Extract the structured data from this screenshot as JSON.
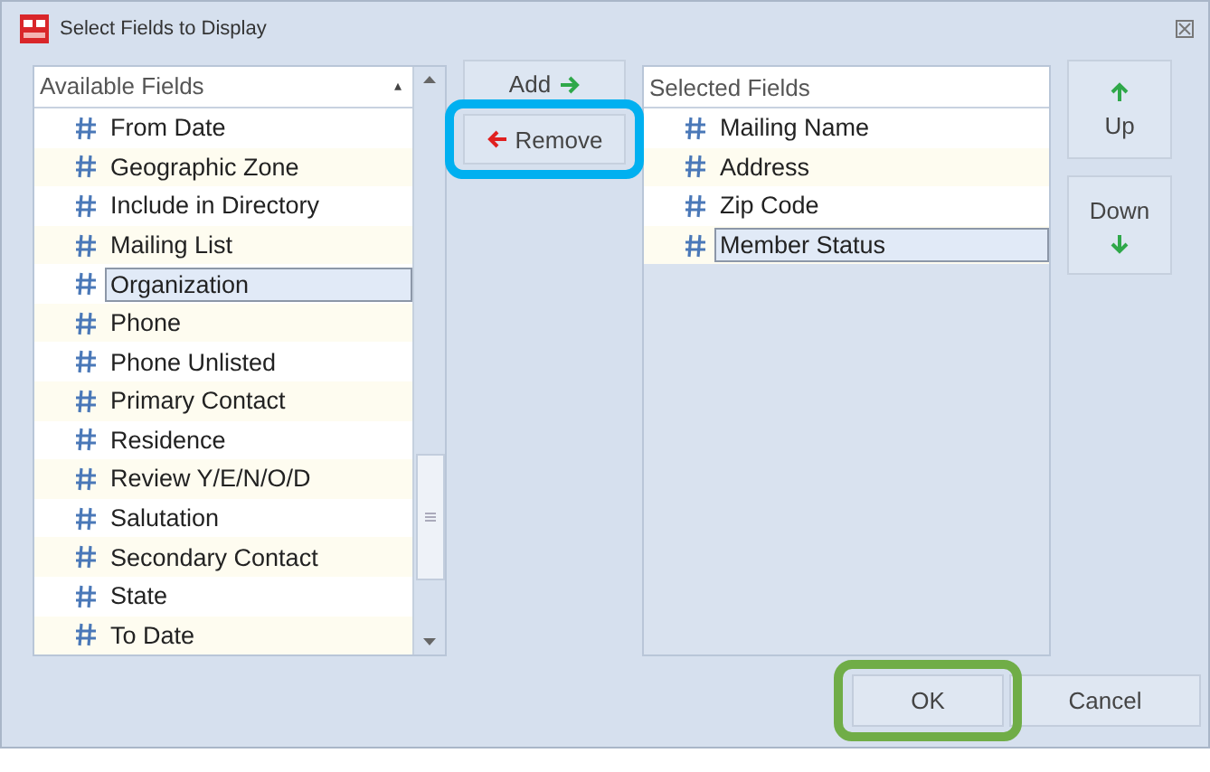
{
  "window": {
    "title": "Select Fields to Display"
  },
  "available_fields": {
    "header": "Available Fields",
    "sort_indicator": "▴",
    "items": [
      {
        "label": "From Date",
        "selected": false
      },
      {
        "label": "Geographic Zone",
        "selected": false
      },
      {
        "label": "Include in Directory",
        "selected": false
      },
      {
        "label": "Mailing List",
        "selected": false
      },
      {
        "label": "Organization",
        "selected": true
      },
      {
        "label": "Phone",
        "selected": false
      },
      {
        "label": "Phone Unlisted",
        "selected": false
      },
      {
        "label": "Primary Contact",
        "selected": false
      },
      {
        "label": "Residence",
        "selected": false
      },
      {
        "label": "Review Y/E/N/O/D",
        "selected": false
      },
      {
        "label": "Salutation",
        "selected": false
      },
      {
        "label": "Secondary Contact",
        "selected": false
      },
      {
        "label": "State",
        "selected": false
      },
      {
        "label": "To Date",
        "selected": false
      }
    ]
  },
  "transfer_buttons": [
    {
      "label": "Add",
      "kind": "right"
    },
    {
      "label": "Remove",
      "kind": "left",
      "color": "#00b0f0"
    }
  ],
  "selected_fields": {
    "header": "Selected Fields",
    "items": [
      {
        "label": "Mailing Name",
        "selected": false
      },
      {
        "label": "Address",
        "selected": false
      },
      {
        "label": "Zip Code",
        "selected": false
      },
      {
        "label": "Member Status",
        "selected": true
      }
    ]
  },
  "order_buttons": [
    {
      "label": "Up",
      "kind": "up"
    },
    {
      "label": "Down",
      "kind": "down"
    }
  ],
  "dialog_buttons": [
    {
      "label": "OK",
      "color": "#70ad47"
    },
    {
      "label": "Cancel"
    }
  ]
}
